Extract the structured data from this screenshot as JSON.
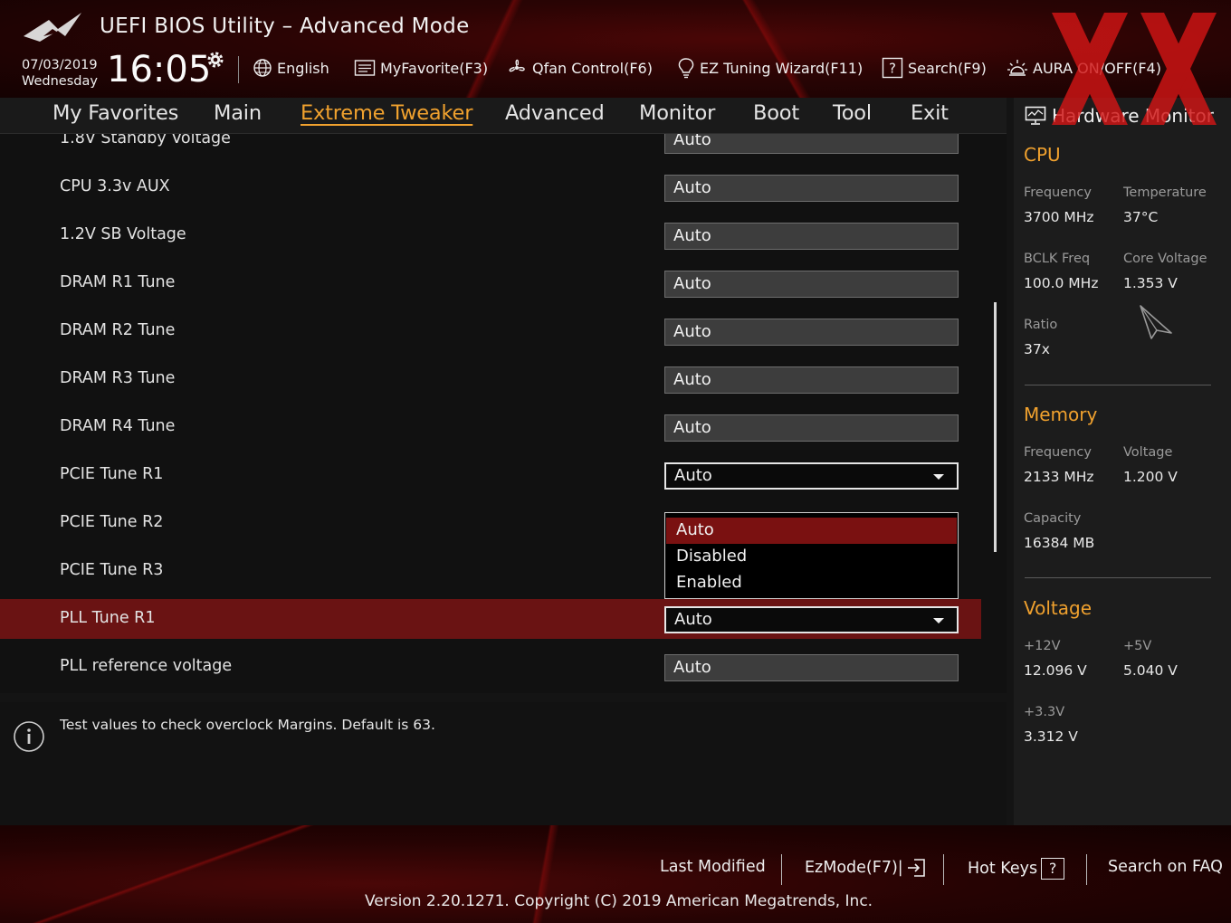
{
  "header": {
    "title": "UEFI BIOS Utility – Advanced Mode",
    "date": "07/03/2019",
    "weekday": "Wednesday",
    "time": "16:05",
    "toolbar": {
      "language": "English",
      "myfavorite": "MyFavorite(F3)",
      "qfan": "Qfan Control(F6)",
      "ez_tuning": "EZ Tuning Wizard(F11)",
      "search": "Search(F9)",
      "aura": "AURA ON/OFF(F4)"
    }
  },
  "nav": {
    "tabs": [
      {
        "label": "My Favorites"
      },
      {
        "label": "Main"
      },
      {
        "label": "Extreme Tweaker",
        "active": true
      },
      {
        "label": "Advanced"
      },
      {
        "label": "Monitor"
      },
      {
        "label": "Boot"
      },
      {
        "label": "Tool"
      },
      {
        "label": "Exit"
      }
    ]
  },
  "settings": {
    "rows": [
      {
        "label": "1.8V Standby Voltage",
        "value": "Auto"
      },
      {
        "label": "CPU 3.3v AUX",
        "value": "Auto"
      },
      {
        "label": "1.2V SB Voltage",
        "value": "Auto"
      },
      {
        "label": "DRAM R1 Tune",
        "value": "Auto"
      },
      {
        "label": "DRAM R2 Tune",
        "value": "Auto"
      },
      {
        "label": "DRAM R3 Tune",
        "value": "Auto"
      },
      {
        "label": "DRAM R4 Tune",
        "value": "Auto"
      },
      {
        "label": "PCIE Tune R1",
        "value": "Auto"
      },
      {
        "label": "PCIE Tune R2",
        "value": ""
      },
      {
        "label": "PCIE Tune R3",
        "value": ""
      },
      {
        "label": "PLL Tune R1",
        "value": "Auto"
      },
      {
        "label": "PLL reference voltage",
        "value": "Auto"
      }
    ],
    "dropdown_options": [
      "Auto",
      "Disabled",
      "Enabled"
    ]
  },
  "help": {
    "text": "Test values to check overclock Margins. Default is 63."
  },
  "hw_monitor": {
    "title": "Hardware Monitor",
    "cpu": {
      "title": "CPU",
      "frequency_label": "Frequency",
      "frequency": "3700 MHz",
      "temperature_label": "Temperature",
      "temperature": "37°C",
      "bclk_label": "BCLK Freq",
      "bclk": "100.0 MHz",
      "core_voltage_label": "Core Voltage",
      "core_voltage": "1.353 V",
      "ratio_label": "Ratio",
      "ratio": "37x"
    },
    "memory": {
      "title": "Memory",
      "frequency_label": "Frequency",
      "frequency": "2133 MHz",
      "voltage_label": "Voltage",
      "voltage": "1.200 V",
      "capacity_label": "Capacity",
      "capacity": "16384 MB"
    },
    "voltage": {
      "title": "Voltage",
      "v12_label": "+12V",
      "v12": "12.096 V",
      "v5_label": "+5V",
      "v5": "5.040 V",
      "v33_label": "+3.3V",
      "v33": "3.312 V"
    }
  },
  "footer": {
    "last_modified": "Last Modified",
    "ezmode": "EzMode(F7)|",
    "hot_keys": "Hot Keys",
    "hot_keys_box": "?",
    "search_faq": "Search on FAQ",
    "version": "Version 2.20.1271. Copyright (C) 2019 American Megatrends, Inc."
  },
  "colors": {
    "accent": "#f0a12e",
    "selection": "#6a1313",
    "dropdown_highlight": "#7a1111"
  },
  "icons": [
    "rog-logo-icon",
    "gear-icon",
    "globe-icon",
    "favorite-list-icon",
    "fan-icon",
    "lightbulb-icon",
    "help-box-icon",
    "aura-icon",
    "monitor-icon",
    "info-icon",
    "cursor-icon",
    "exit-arrow-icon"
  ]
}
